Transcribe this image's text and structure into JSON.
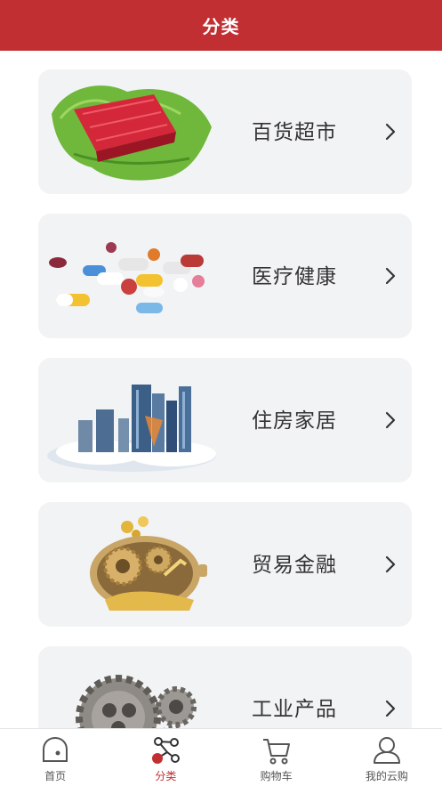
{
  "header": {
    "title": "分类"
  },
  "categories": [
    {
      "label": "百货超市",
      "icon": "meat-vegetable-image"
    },
    {
      "label": "医疗健康",
      "icon": "pills-image"
    },
    {
      "label": "住房家居",
      "icon": "city-buildings-image"
    },
    {
      "label": "贸易金融",
      "icon": "piggy-bank-gears-image"
    },
    {
      "label": "工业产品",
      "icon": "gears-image"
    }
  ],
  "tabbar": {
    "items": [
      {
        "label": "首页",
        "icon": "home-icon",
        "active": false
      },
      {
        "label": "分类",
        "icon": "category-icon",
        "active": true
      },
      {
        "label": "购物车",
        "icon": "cart-icon",
        "active": false
      },
      {
        "label": "我的云购",
        "icon": "user-icon",
        "active": false
      }
    ]
  },
  "colors": {
    "brand": "#c22f33",
    "card_bg": "#f2f3f5",
    "text": "#333333"
  }
}
